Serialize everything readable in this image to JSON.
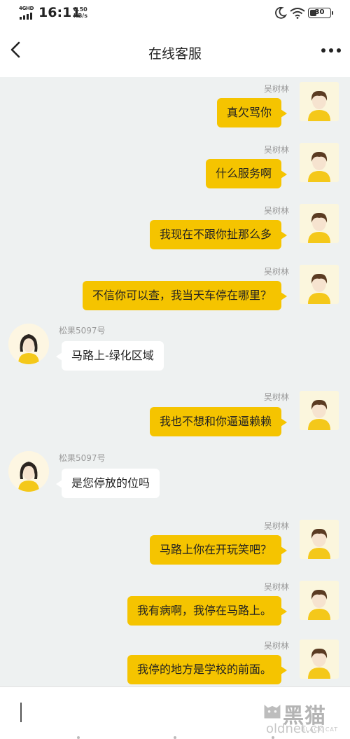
{
  "status_bar": {
    "network": "4GHD",
    "time": "16:11",
    "speed_value": "0.50",
    "speed_unit": "KB/s",
    "battery": "30",
    "icons": [
      "signal-icon",
      "moon-icon",
      "wifi-icon",
      "battery-icon"
    ]
  },
  "header": {
    "title": "在线客服",
    "back_icon": "chevron-left-icon",
    "more_icon": "more-dots-icon"
  },
  "messages": [
    {
      "side": "me",
      "sender": "吴树林",
      "text": "真欠骂你"
    },
    {
      "side": "me",
      "sender": "吴树林",
      "text": "什么服务啊"
    },
    {
      "side": "me",
      "sender": "吴树林",
      "text": "我现在不跟你扯那么多"
    },
    {
      "side": "me",
      "sender": "吴树林",
      "text": "不信你可以查，我当天车停在哪里？"
    },
    {
      "side": "agent",
      "sender": "松果5097号",
      "text": "马路上-绿化区域"
    },
    {
      "side": "me",
      "sender": "吴树林",
      "text": "我也不想和你逼逼赖赖"
    },
    {
      "side": "agent",
      "sender": "松果5097号",
      "text": "是您停放的位吗"
    },
    {
      "side": "me",
      "sender": "吴树林",
      "text": "马路上你在开玩笑吧？"
    },
    {
      "side": "me",
      "sender": "吴树林",
      "text": "我有病啊，我停在马路上。"
    },
    {
      "side": "me",
      "sender": "吴树林",
      "text": "我停的地方是学校的前面。"
    }
  ],
  "input": {
    "value": "",
    "placeholder": ""
  },
  "watermark": {
    "text": "黑猫",
    "sub": "oldnet.cn",
    "sub2": "BLACK CAT"
  },
  "colors": {
    "outgoing_bubble": "#f5c400",
    "incoming_bubble": "#ffffff",
    "chat_background": "#eef1f1"
  }
}
